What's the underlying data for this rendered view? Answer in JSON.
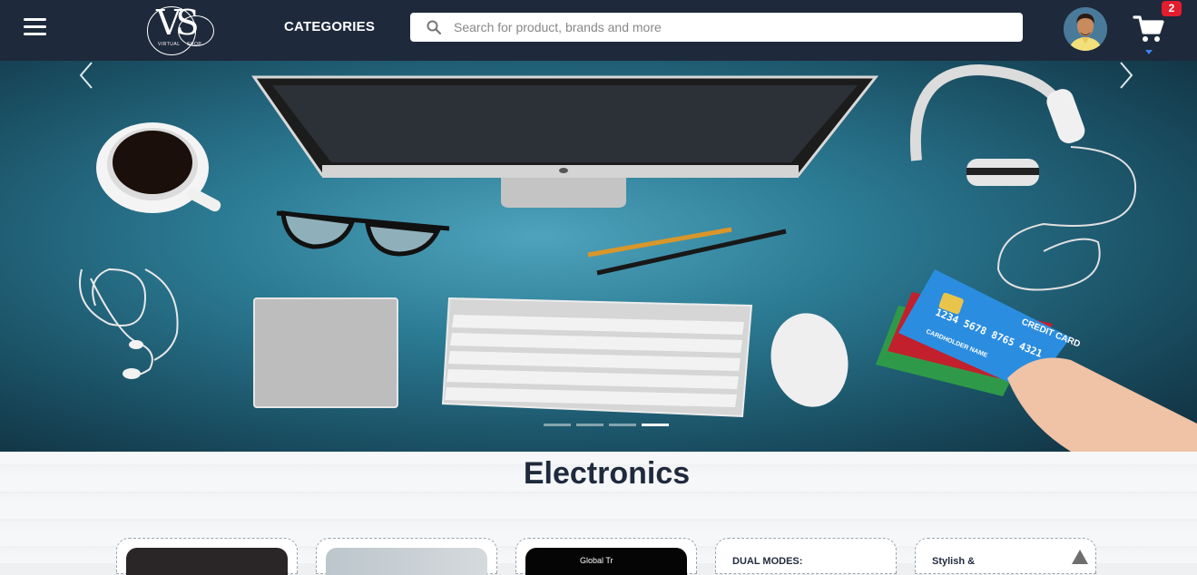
{
  "header": {
    "logo_text": "VS",
    "logo_sub_left": "VIRTUAL",
    "logo_sub_right": "SHOP",
    "categories_label": "CATEGORIES",
    "search_placeholder": "Search for product, brands and more",
    "cart_count": "2"
  },
  "hero": {
    "slides": 4,
    "active_slide": 4,
    "card_number": "1234 5678 8765 4321",
    "card_label": "CREDIT CARD",
    "card_holder": "CARDHOLDER NAME"
  },
  "section": {
    "title": "Electronics",
    "cards": [
      {
        "text": ""
      },
      {
        "text": ""
      },
      {
        "text": "Global Tr"
      },
      {
        "text": "DUAL MODES:"
      },
      {
        "text": "Stylish &"
      }
    ]
  },
  "colors": {
    "header_bg": "#1e293b",
    "badge": "#e11d2e",
    "title": "#1f2a3d"
  }
}
